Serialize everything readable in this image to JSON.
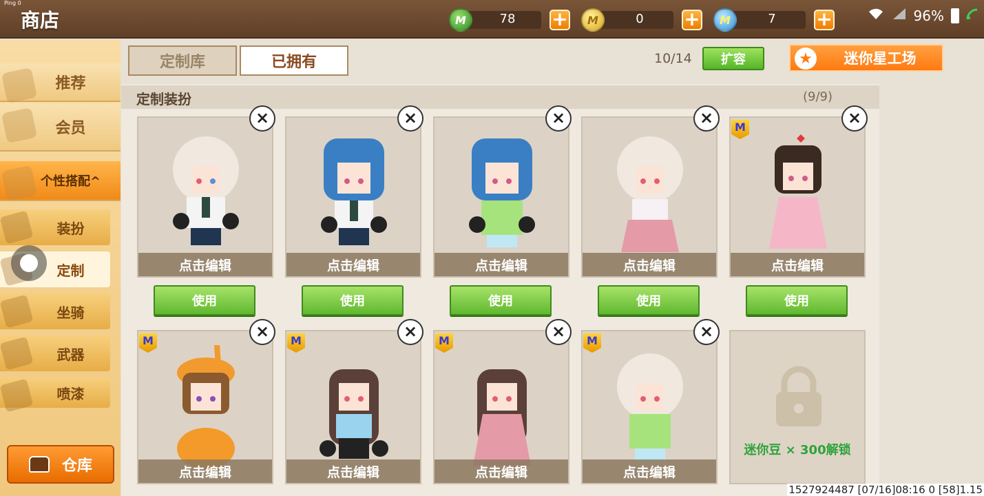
{
  "topbar": {
    "title": "商店",
    "ping": "Ping 0",
    "currencies": [
      {
        "id": "mini-coin-green",
        "symbol": "M",
        "amount": "78"
      },
      {
        "id": "mini-coin-gold",
        "symbol": "M",
        "amount": "0"
      },
      {
        "id": "mini-coin-blue",
        "symbol": "M",
        "amount": "7"
      }
    ],
    "plus_label": "+",
    "status": {
      "wifi": "WiFi",
      "battery": "96%"
    }
  },
  "sidebar": {
    "items": [
      {
        "label": "推荐"
      },
      {
        "label": "会员"
      },
      {
        "label": "个性搭配^"
      }
    ],
    "subitems": [
      {
        "label": "装扮"
      },
      {
        "label": "定制"
      },
      {
        "label": "坐骑"
      },
      {
        "label": "武器"
      },
      {
        "label": "喷漆"
      }
    ],
    "warehouse": "仓库"
  },
  "tabs": {
    "custom_library": "定制库",
    "owned": "已拥有"
  },
  "capacity": "10/14",
  "expand_label": "扩容",
  "mini_star_label": "迷你星工场",
  "panel": {
    "title": "定制装扮",
    "count": "(9/9)"
  },
  "cards": {
    "edit_label": "点击编辑",
    "use_label": "使用",
    "close_label": "×",
    "badge_label": "M"
  },
  "locked": {
    "text_prefix": "迷你豆",
    "times": "× 300",
    "text_suffix": "解锁"
  },
  "footer": "1527924487   [07/16]08:16 0   [58]1.15",
  "colors": {
    "accent_orange": "#ff7a10",
    "use_green": "#61b830",
    "sidebar_bg": "#f0c77e"
  }
}
